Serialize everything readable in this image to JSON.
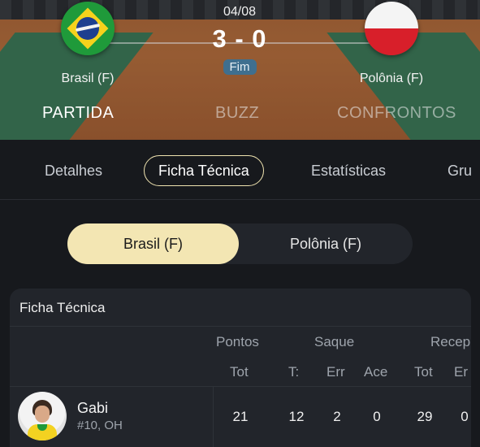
{
  "match": {
    "date": "04/08",
    "score": "3 - 0",
    "status": "Fim",
    "home": {
      "name": "Brasil (F)",
      "flag": "brazil-flag"
    },
    "away": {
      "name": "Polônia (F)",
      "flag": "poland-flag"
    }
  },
  "main_tabs": [
    {
      "label": "PARTIDA",
      "active": true
    },
    {
      "label": "BUZZ",
      "active": false
    },
    {
      "label": "CONFRONTOS",
      "active": false
    }
  ],
  "sub_tabs": [
    {
      "label": "Detalhes",
      "active": false
    },
    {
      "label": "Ficha Técnica",
      "active": true
    },
    {
      "label": "Estatísticas",
      "active": false
    },
    {
      "label": "Gru",
      "active": false
    }
  ],
  "team_toggle": {
    "selected": "Brasil (F)",
    "other": "Polônia (F)"
  },
  "stats_card": {
    "title": "Ficha Técnica",
    "groups": [
      "Pontos",
      "Saque",
      "Recep"
    ],
    "sub_headers": [
      "Tot",
      "T:",
      "Err",
      "Ace",
      "Tot",
      "Er"
    ],
    "players": [
      {
        "name": "Gabi",
        "meta": "#10, OH",
        "values": [
          "21",
          "12",
          "2",
          "0",
          "29",
          "0"
        ]
      }
    ]
  },
  "colors": {
    "accent_cream": "#f3e6b3",
    "background": "#17191d",
    "card": "#22252b",
    "status_pill": "#3f6f8f"
  }
}
